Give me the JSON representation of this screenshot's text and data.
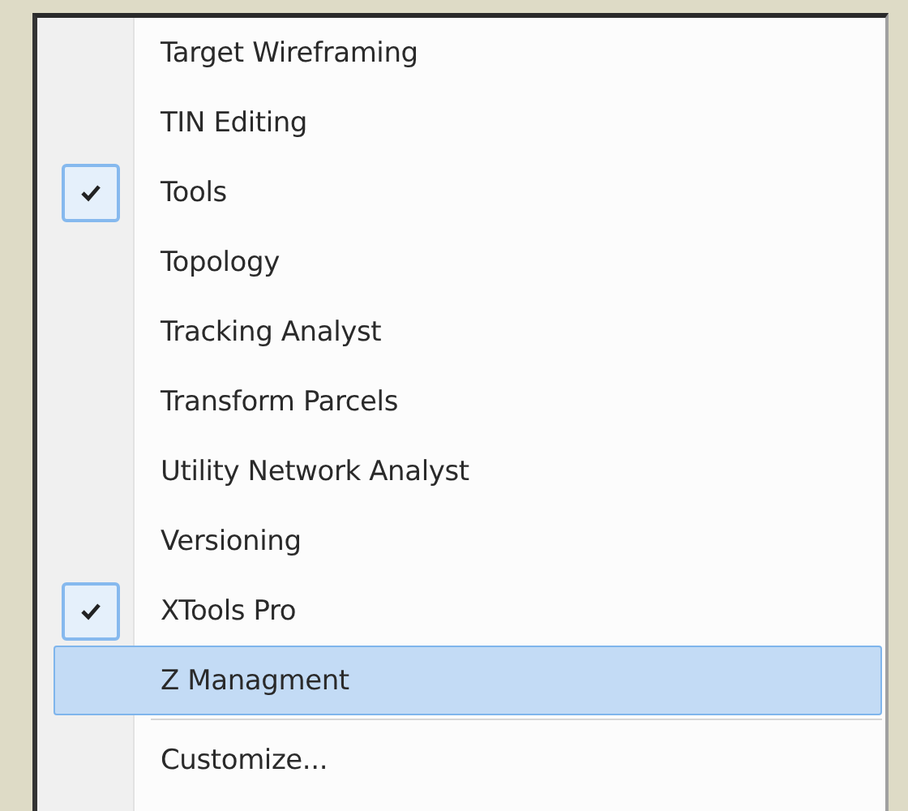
{
  "menu": {
    "items": [
      {
        "kind": "item",
        "label": "Target Wireframing",
        "checked": false,
        "selected": false
      },
      {
        "kind": "item",
        "label": "TIN Editing",
        "checked": false,
        "selected": false
      },
      {
        "kind": "item",
        "label": "Tools",
        "checked": true,
        "selected": false
      },
      {
        "kind": "item",
        "label": "Topology",
        "checked": false,
        "selected": false
      },
      {
        "kind": "item",
        "label": "Tracking Analyst",
        "checked": false,
        "selected": false
      },
      {
        "kind": "item",
        "label": "Transform Parcels",
        "checked": false,
        "selected": false
      },
      {
        "kind": "item",
        "label": "Utility Network Analyst",
        "checked": false,
        "selected": false
      },
      {
        "kind": "item",
        "label": "Versioning",
        "checked": false,
        "selected": false
      },
      {
        "kind": "item",
        "label": "XTools Pro",
        "checked": true,
        "selected": false
      },
      {
        "kind": "item",
        "label": "Z Managment",
        "checked": false,
        "selected": true
      },
      {
        "kind": "separator"
      },
      {
        "kind": "item",
        "label": "Customize...",
        "checked": false,
        "selected": false
      }
    ]
  }
}
